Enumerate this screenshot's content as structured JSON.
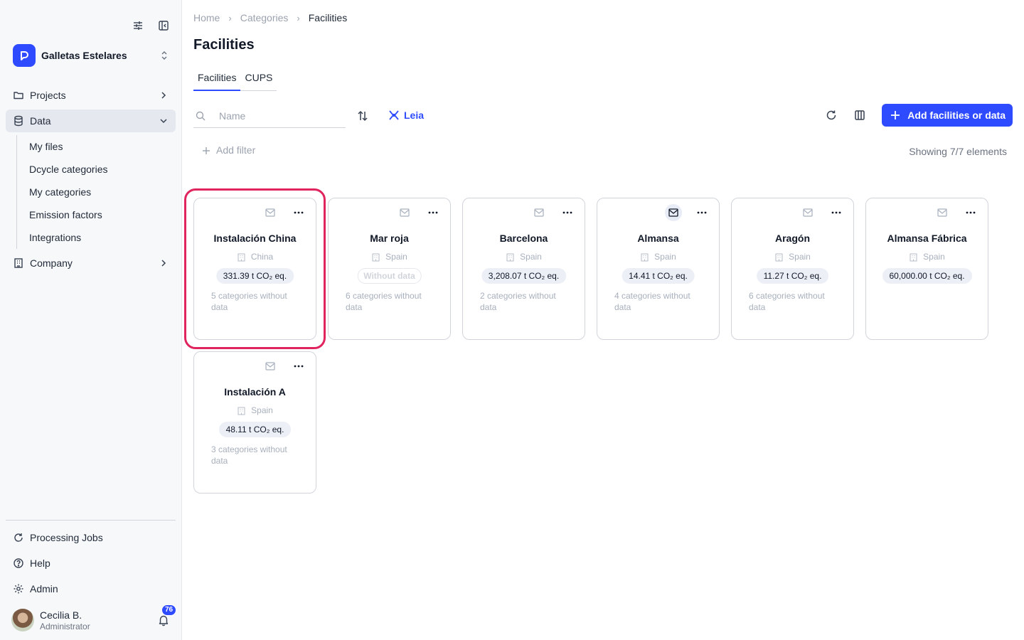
{
  "sidebar": {
    "org_name": "Galletas Estelares",
    "nav": [
      {
        "label": "Projects",
        "icon": "folder-icon"
      },
      {
        "label": "Data",
        "icon": "database-icon"
      },
      {
        "label": "Company",
        "icon": "building-icon"
      }
    ],
    "data_subitems": [
      "My files",
      "Dcycle categories",
      "My categories",
      "Emission factors",
      "Integrations"
    ],
    "bottom": [
      {
        "label": "Processing Jobs",
        "icon": "refresh-icon"
      },
      {
        "label": "Help",
        "icon": "help-icon"
      },
      {
        "label": "Admin",
        "icon": "gear-icon"
      }
    ],
    "user": {
      "name": "Cecilia B.",
      "role": "Administrator",
      "notifications": "76"
    }
  },
  "breadcrumb": [
    "Home",
    "Categories",
    "Facilities"
  ],
  "page_title": "Facilities",
  "tabs": [
    "Facilities",
    "CUPS"
  ],
  "toolbar": {
    "search_placeholder": "Name",
    "leia_label": "Leia",
    "add_button": "Add facilities or data",
    "add_filter": "Add filter",
    "showing": "Showing 7/7 elements"
  },
  "cards": [
    {
      "name": "Instalación China",
      "country": "China",
      "emissions": "331.39 t CO₂ eq.",
      "note": "5 categories without data"
    },
    {
      "name": "Mar roja",
      "country": "Spain",
      "emissions": "Without data",
      "note": "6 categories without data"
    },
    {
      "name": "Barcelona",
      "country": "Spain",
      "emissions": "3,208.07 t CO₂ eq.",
      "note": "2 categories without data"
    },
    {
      "name": "Almansa",
      "country": "Spain",
      "emissions": "14.41 t CO₂ eq.",
      "note": "4 categories without data"
    },
    {
      "name": "Aragón",
      "country": "Spain",
      "emissions": "11.27 t CO₂ eq.",
      "note": "6 categories without data"
    },
    {
      "name": "Almansa Fábrica",
      "country": "Spain",
      "emissions": "60,000.00 t CO₂ eq.",
      "note": ""
    },
    {
      "name": "Instalación A",
      "country": "Spain",
      "emissions": "48.11 t CO₂ eq.",
      "note": "3 categories without data"
    }
  ],
  "colors": {
    "accent": "#2f4bff",
    "highlight": "#e0245e"
  }
}
